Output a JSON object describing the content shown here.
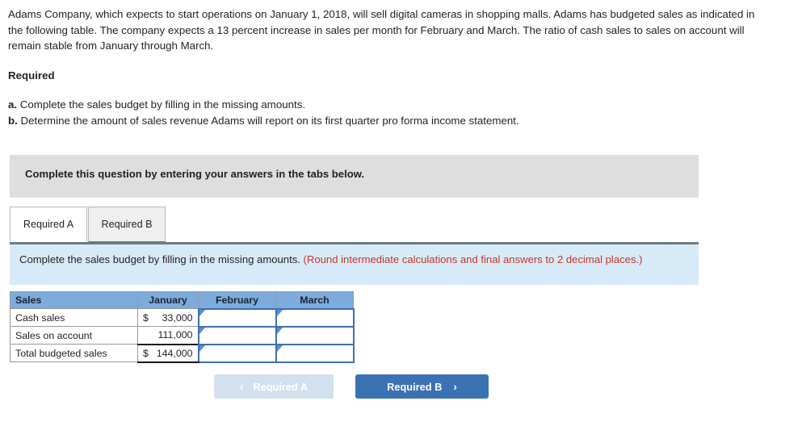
{
  "intro": {
    "paragraph": "Adams Company, which expects to start operations on January 1, 2018, will sell digital cameras in shopping malls. Adams has budgeted sales as indicated in the following table. The company expects a 13 percent increase in sales per month for February and March. The ratio of cash sales to sales on account will remain stable from January through March."
  },
  "required": {
    "heading": "Required",
    "items": [
      {
        "marker": "a.",
        "text": "Complete the sales budget by filling in the missing amounts."
      },
      {
        "marker": "b.",
        "text": "Determine the amount of sales revenue Adams will report on its first quarter pro forma income statement."
      }
    ]
  },
  "banner": {
    "text": "Complete this question by entering your answers in the tabs below."
  },
  "tabs": [
    {
      "label": "Required A",
      "active": true
    },
    {
      "label": "Required B",
      "active": false
    }
  ],
  "instruction": {
    "main": "Complete the sales budget by filling in the missing amounts.",
    "note": "(Round intermediate calculations and final answers to 2 decimal places.)",
    "note_color": "#c0392b"
  },
  "table": {
    "headers": [
      "Sales",
      "January",
      "February",
      "March"
    ],
    "rows": [
      {
        "label": "Cash sales",
        "january_currency": "$",
        "january_value": "33,000",
        "february_value": "",
        "march_value": "",
        "total_row": false
      },
      {
        "label": "Sales on account",
        "january_currency": "",
        "january_value": "111,000",
        "february_value": "",
        "march_value": "",
        "total_row": false
      },
      {
        "label": "Total budgeted sales",
        "january_currency": "$",
        "january_value": "144,000",
        "february_value": "",
        "march_value": "",
        "total_row": true
      }
    ],
    "header_bg": "#7cabdc",
    "input_border": "#3f6fae"
  },
  "nav": {
    "prev_label": "Required A",
    "prev_chevron": "‹",
    "next_label": "Required B",
    "next_chevron": "›",
    "prev_bg": "#d2e0ef",
    "next_bg": "#3b72b4"
  }
}
